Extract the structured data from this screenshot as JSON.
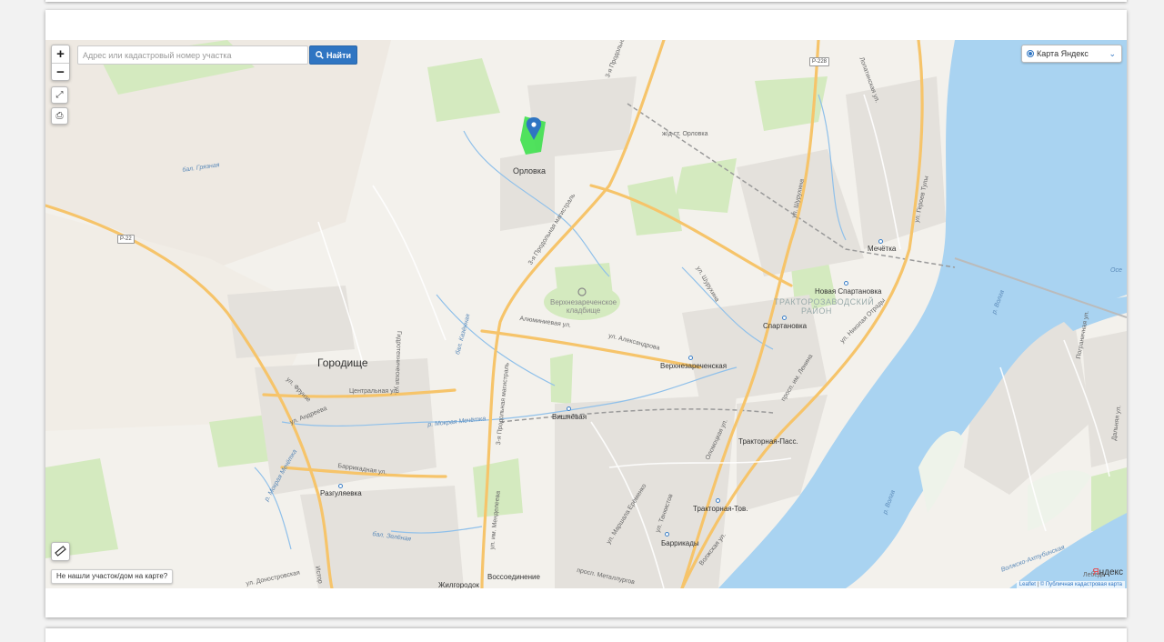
{
  "controls": {
    "zoom_in": "+",
    "zoom_out": "−",
    "search_placeholder": "Адрес или кадастровый номер участка",
    "find_label": "Найти",
    "layer_label": "Карта Яндекс",
    "not_found": "Не нашли участок/дом на карте?"
  },
  "attribution": {
    "leaflet": "Leaflet",
    "pkk": "© Публичная кадастровая карта",
    "yandex": "Яндекс"
  },
  "labels": {
    "orlovka": "Орловка",
    "gorodishe": "Городище",
    "razgulyaevka": "Разгуляевка",
    "vishnevaya": "Вишнёвая",
    "verkhnezar": "Верхнезареченская",
    "spartanovka": "Спартановка",
    "nov_spartanovka": "Новая Спартановка",
    "mechetka": "Мечётка",
    "traktor_pass": "Тракторная-Пасс.",
    "traktor_tov": "Тракторная-Тов.",
    "barrikady": "Баррикады",
    "vossoedinenie": "Воссоединение",
    "zhilgorodok": "Жилгородок",
    "zhd_orlovka": "ж/д ст. Орловка",
    "district_line1": "ТРАКТОРОЗАВОДСКИЙ",
    "district_line2": "РАЙОН",
    "cemetery_line1": "Верхнезареченское",
    "cemetery_line2": "кладбище",
    "magistral_top": "3-я Продольная магистраль",
    "magistral_mid": "3-я Продольная магистраль",
    "magistral_low": "3-я Продольная магистраль",
    "ul_shurukhina": "ул. Шурухина",
    "ul_shurukhina2": "ул. Шурухина",
    "ul_alexandrova": "ул. Александрова",
    "alyuminievaya": "Алюминиевая ул.",
    "tsentralnaya": "Центральная ул.",
    "ul_andreeva": "ул. Андреева",
    "ul_frunze": "ул. Фрунзе",
    "barrikadnaya": "Баррикадная ул.",
    "gidrotekhnicheskaya": "Гидротехническая ул.",
    "ul_mendeleeva": "ул. им. Менделеева",
    "ul_eremenko": "ул. Маршала Ерёменко",
    "ul_tankistov": "ул. Танкистов",
    "ogorodnaya": "Оломоцкая ул.",
    "pr_lenina": "просп. им. Ленина",
    "ul_nik_otrady": "ул. Николая Отрады",
    "ul_geroev_tuly": "ул. Героев Тулы",
    "loponinskaya": "Лопатинская ул.",
    "pr_metallurgov": "просп. Металлургов",
    "volzhskaya": "Волжская ул.",
    "ul_donskaya": "ул. Доностровская",
    "pogranichnaya": "Пограничная ул.",
    "dalnyaya": "Дальняя ул.",
    "istor": "Истор",
    "r22": "Р-22",
    "r228": "Р-228",
    "balka_gryaznaya": "бал. Грязная",
    "balka_kazennaya": "бал. Казённая",
    "balka_zelenaya": "бал. Зелёная",
    "r_mokraya_mechetka": "р. Мокрая Мечётка",
    "r_mokraya_mechetka2": "р. Мокрая Мечётка",
    "r_volga": "р. Волга",
    "r_volga2": "р. Волга",
    "volzhskaya_akhtuba": "Волжско-Ахтубинская",
    "osa": "Осе",
    "lebedev": "Лебедь"
  },
  "colors": {
    "water": "#a9d3f1",
    "parcel": "#3ee04e",
    "pin": "#2f75c2",
    "road": "#f6c46a",
    "green": "#cfe9b4",
    "accent": "#2f75c2"
  }
}
